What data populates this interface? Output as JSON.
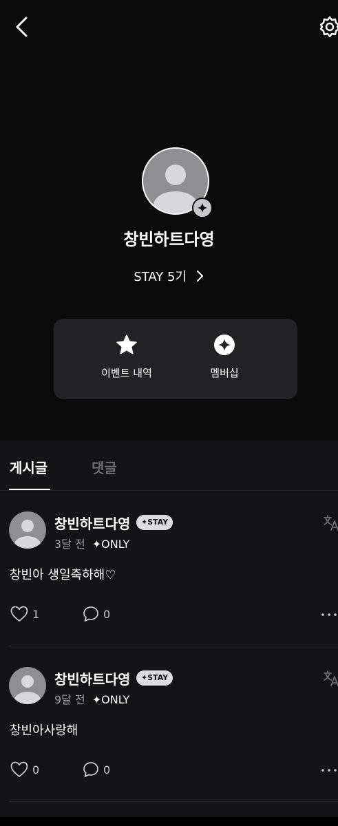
{
  "header": {
    "back_icon": "chevron-left-icon",
    "settings_icon": "gear-icon"
  },
  "profile": {
    "name": "창빈하트다영",
    "membership_link": "STAY 5기",
    "avatar_icon": "default-user-icon",
    "badge_icon": "sparkle-icon"
  },
  "actions": [
    {
      "label": "이벤트 내역",
      "icon": "star-icon"
    },
    {
      "label": "멤버십",
      "icon": "sparkle-circle-icon"
    }
  ],
  "tabs": [
    {
      "label": "게시글",
      "active": true
    },
    {
      "label": "댓글",
      "active": false
    }
  ],
  "posts": [
    {
      "author": "창빈하트다영",
      "badge": "✦STAY",
      "time": "3달 전",
      "visibility": "✦ONLY",
      "text": "창빈아 생일축하해♡",
      "likes": "1",
      "comments": "0"
    },
    {
      "author": "창빈하트다영",
      "badge": "✦STAY",
      "time": "9달 전",
      "visibility": "✦ONLY",
      "text": "창빈아사랑해",
      "likes": "0",
      "comments": "0"
    }
  ],
  "colors": {
    "background_top": "#0b0b0c",
    "background_feed": "#141417",
    "card": "#232326",
    "badge": "#dcdce0",
    "muted_text": "#9a9aa0"
  }
}
